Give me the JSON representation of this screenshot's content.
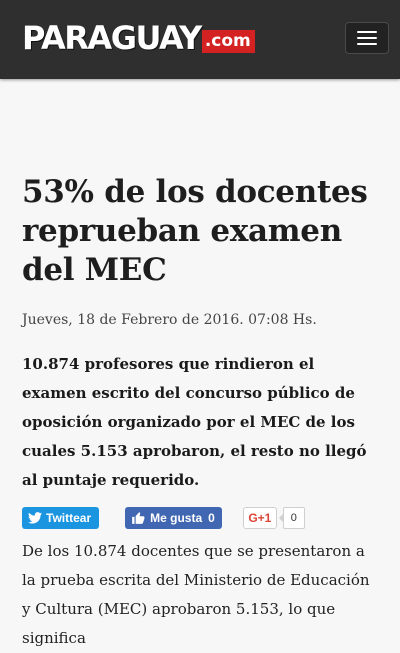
{
  "header": {
    "logo_main": "PARAGUAY",
    "logo_suffix": ".com",
    "brand_color": "#d42121",
    "menu_icon": "hamburger-icon"
  },
  "article": {
    "headline": "53% de los docentes reprueban examen del MEC",
    "date": "Jueves, 18 de Febrero de 2016. 07:08 Hs.",
    "lead": "10.874 profesores que rindieron el examen escrito del concurso público de oposición organizado por el MEC de los cuales 5.153 aprobaron, el resto no llegó al puntaje requerido.",
    "body": "De los 10.874 docentes que se presentaron a la prueba escrita del Ministerio de Educación y Cultura (MEC) aprobaron 5.153, lo que significa"
  },
  "share": {
    "twitter_label": "Twittear",
    "twitter_icon": "twitter-bird-icon",
    "twitter_color": "#1b95e0",
    "facebook_label": "Me gusta",
    "facebook_count": "0",
    "facebook_icon": "thumbs-up-icon",
    "facebook_color": "#4267b2",
    "gplus_label": "G+1",
    "gplus_count": "0",
    "gplus_color": "#db4437"
  }
}
